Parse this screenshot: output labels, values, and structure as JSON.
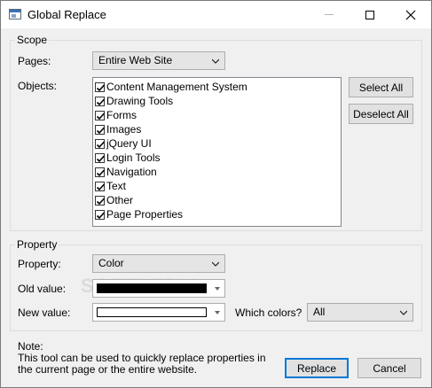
{
  "window": {
    "title": "Global Replace",
    "controls": {
      "minimize": "minimize",
      "maximize": "maximize",
      "close": "close"
    }
  },
  "scope": {
    "group_label": "Scope",
    "pages_label": "Pages:",
    "pages_value": "Entire Web Site",
    "objects_label": "Objects:",
    "objects": [
      {
        "label": "Content Management System",
        "checked": true
      },
      {
        "label": "Drawing Tools",
        "checked": true
      },
      {
        "label": "Forms",
        "checked": true
      },
      {
        "label": "Images",
        "checked": true
      },
      {
        "label": "jQuery UI",
        "checked": true
      },
      {
        "label": "Login Tools",
        "checked": true
      },
      {
        "label": "Navigation",
        "checked": true
      },
      {
        "label": "Text",
        "checked": true
      },
      {
        "label": "Other",
        "checked": true
      },
      {
        "label": "Page Properties",
        "checked": true
      }
    ],
    "select_all": "Select All",
    "deselect_all": "Deselect All"
  },
  "property": {
    "group_label": "Property",
    "property_label": "Property:",
    "property_value": "Color",
    "old_value_label": "Old value:",
    "old_value_color": "#000000",
    "new_value_label": "New value:",
    "new_value_color": "#ffffff",
    "which_colors_label": "Which colors?",
    "which_colors_value": "All"
  },
  "note": {
    "title": "Note:",
    "text": "This tool can be used to quickly replace properties in the current page or the entire website."
  },
  "buttons": {
    "replace": "Replace",
    "cancel": "Cancel"
  },
  "watermark": "SOFTPEDIA",
  "colors": {
    "accent": "#0078d7",
    "button_face": "#e1e1e1",
    "window_bg": "#f0f0f0"
  }
}
